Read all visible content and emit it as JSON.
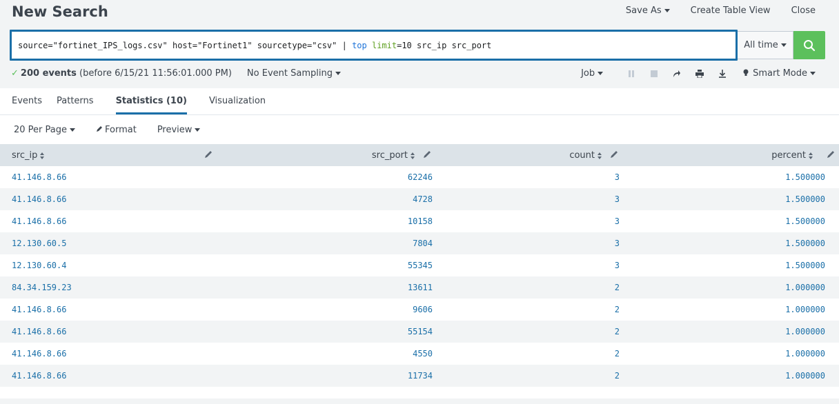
{
  "header": {
    "title": "New Search",
    "actions": {
      "save_as": "Save As",
      "create_table_view": "Create Table View",
      "close": "Close"
    }
  },
  "search": {
    "query_parts": {
      "p1": "source=\"fortinet_IPS_logs.csv\" host=\"Fortinet1\" sourcetype=\"csv\" | ",
      "command": "top",
      "space": " ",
      "arg": "limit",
      "rest": "=10 src_ip src_port"
    },
    "time_range": "All time"
  },
  "status": {
    "events": "200 events",
    "before": "(before 6/15/21 11:56:01.000 PM)",
    "sampling": "No Event Sampling",
    "job": "Job",
    "mode": "Smart Mode"
  },
  "tabs": [
    {
      "label": "Events"
    },
    {
      "label": "Patterns"
    },
    {
      "label": "Statistics (10)"
    },
    {
      "label": "Visualization"
    }
  ],
  "toolbar": {
    "per_page": "20 Per Page",
    "format": "Format",
    "preview": "Preview"
  },
  "table": {
    "columns": [
      "src_ip",
      "src_port",
      "count",
      "percent"
    ],
    "rows": [
      [
        "41.146.8.66",
        "62246",
        "3",
        "1.500000"
      ],
      [
        "41.146.8.66",
        "4728",
        "3",
        "1.500000"
      ],
      [
        "41.146.8.66",
        "10158",
        "3",
        "1.500000"
      ],
      [
        "12.130.60.5",
        "7804",
        "3",
        "1.500000"
      ],
      [
        "12.130.60.4",
        "55345",
        "3",
        "1.500000"
      ],
      [
        "84.34.159.23",
        "13611",
        "2",
        "1.000000"
      ],
      [
        "41.146.8.66",
        "9606",
        "2",
        "1.000000"
      ],
      [
        "41.146.8.66",
        "55154",
        "2",
        "1.000000"
      ],
      [
        "41.146.8.66",
        "4550",
        "2",
        "1.000000"
      ],
      [
        "41.146.8.66",
        "11734",
        "2",
        "1.000000"
      ]
    ]
  },
  "colors": {
    "accent": "#1a6fa8",
    "search_button": "#5cc05c",
    "keyword": "#1e74d9",
    "argument": "#5fa022"
  }
}
